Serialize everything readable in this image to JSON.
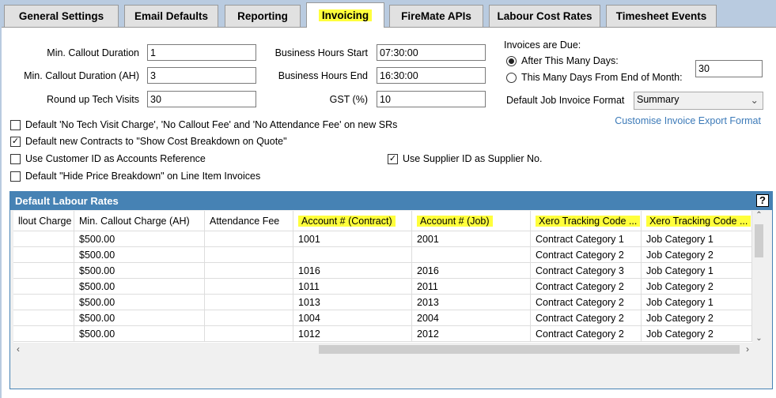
{
  "tabs": [
    {
      "label": "General Settings"
    },
    {
      "label": "Email Defaults"
    },
    {
      "label": "Reporting"
    },
    {
      "label": "Invoicing",
      "active": true
    },
    {
      "label": "FireMate APIs"
    },
    {
      "label": "Labour Cost Rates"
    },
    {
      "label": "Timesheet Events"
    }
  ],
  "fields": {
    "min_callout": {
      "label": "Min. Callout Duration",
      "value": "1"
    },
    "min_callout_ah": {
      "label": "Min. Callout Duration (AH)",
      "value": "3"
    },
    "round_up": {
      "label": "Round up Tech Visits",
      "value": "30"
    },
    "bh_start": {
      "label": "Business Hours Start",
      "value": "07:30:00"
    },
    "bh_end": {
      "label": "Business Hours End",
      "value": "16:30:00"
    },
    "gst": {
      "label": "GST (%)",
      "value": "10"
    }
  },
  "invoices_due": {
    "label": "Invoices are Due:",
    "option1": "After This Many Days:",
    "option2": "This Many Days From End of Month:",
    "days": "30",
    "format_label": "Default Job Invoice Format",
    "format_value": "Summary",
    "link": "Customise Invoice Export Format"
  },
  "checkboxes": [
    {
      "label": "Default 'No Tech Visit Charge', 'No Callout Fee' and 'No Attendance Fee' on new SRs",
      "checked": false
    },
    {
      "label": "Default new Contracts to \"Show Cost Breakdown on Quote\"",
      "checked": true
    },
    {
      "label": "Use Customer ID as Accounts Reference",
      "checked": false
    },
    {
      "label": "Default \"Hide Price Breakdown\" on Line Item Invoices",
      "checked": false
    },
    {
      "label": "Use Supplier ID as Supplier No.",
      "checked": true
    }
  ],
  "grid": {
    "title": "Default Labour Rates",
    "help": "?",
    "columns": [
      "llout Charge",
      "Min. Callout Charge (AH)",
      "Attendance Fee",
      "Account # (Contract)",
      "Account # (Job)",
      "Xero Tracking Code ...",
      "Xero Tracking Code ..."
    ],
    "rows": [
      [
        "",
        "$500.00",
        "",
        "1001",
        "2001",
        "Contract Category 1",
        "Job Category 1"
      ],
      [
        "",
        "$500.00",
        "",
        "",
        "",
        "Contract Category 2",
        "Job Category 2"
      ],
      [
        "",
        "$500.00",
        "",
        "1016",
        "2016",
        "Contract Category 3",
        "Job Category 1"
      ],
      [
        "",
        "$500.00",
        "",
        "1011",
        "2011",
        "Contract Category 2",
        "Job Category 2"
      ],
      [
        "",
        "$500.00",
        "",
        "1013",
        "2013",
        "Contract Category 2",
        "Job Category 1"
      ],
      [
        "",
        "$500.00",
        "",
        "1004",
        "2004",
        "Contract Category 2",
        "Job Category 2"
      ],
      [
        "",
        "$500.00",
        "",
        "1012",
        "2012",
        "Contract Category 2",
        "Job Category 2"
      ]
    ]
  }
}
